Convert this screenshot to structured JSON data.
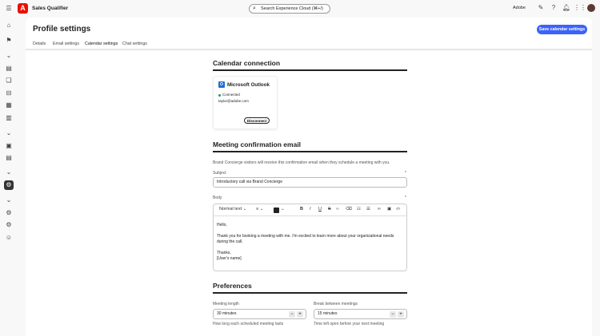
{
  "app": {
    "name": "Sales Qualifier",
    "org": "Adobe",
    "search_placeholder": "Search Experience Cloud (⌘+/)",
    "brand_color": "#eb1000",
    "accent": "#3b63fb"
  },
  "page": {
    "title": "Profile settings",
    "save_label": "Save calendar settings",
    "tabs": [
      {
        "label": "Details"
      },
      {
        "label": "Email settings"
      },
      {
        "label": "Calendar settings"
      },
      {
        "label": "Chat settings"
      }
    ]
  },
  "calendar": {
    "heading": "Calendar connection",
    "provider": "Microsoft Outlook",
    "status": "Connected",
    "email": "taylor@adobe.com",
    "disconnect_label": "Disconnect"
  },
  "email": {
    "heading": "Meeting confirmation email",
    "description": "Brand Concierge visitors will receive this confirmation email when they schedule a meeting with you.",
    "subject_label": "Subject",
    "subject_value": "Introductory call via Brand Concierge",
    "required": "*",
    "body_label": "Body",
    "text_style": "Normal text",
    "body_lines": [
      "Hello,",
      "Thank you for booking a meeting with me. I'm excited to learn more about your organizational needs during the call.",
      "Thanks,",
      "[User's name]"
    ]
  },
  "preferences": {
    "heading": "Preferences",
    "meeting_length": {
      "label": "Meeting length",
      "value": "30 minutes",
      "help": "How long each scheduled meeting lasts"
    },
    "break": {
      "label": "Break between meetings",
      "value": "15 minutes",
      "help": "Time left open before your next meeting"
    }
  }
}
